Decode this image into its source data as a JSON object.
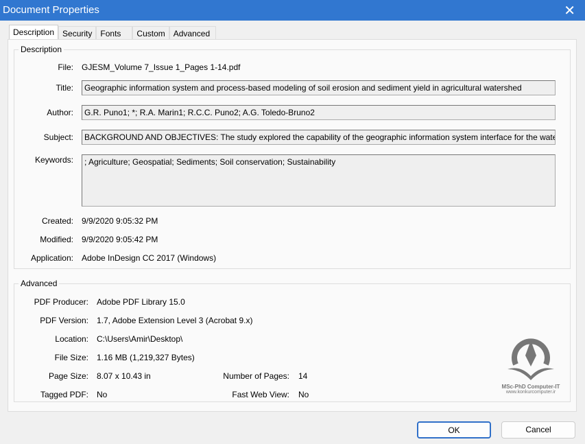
{
  "window": {
    "title": "Document Properties"
  },
  "tabs": [
    "Description",
    "Security",
    "Fonts",
    "Custom",
    "Advanced"
  ],
  "description": {
    "legend": "Description",
    "file_label": "File:",
    "file": "GJESM_Volume 7_Issue 1_Pages 1-14.pdf",
    "title_label": "Title:",
    "title": "Geographic information system and process-based modeling of soil erosion and sediment yield in agricultural watershed",
    "author_label": "Author:",
    "author": "G.R. Puno1; *; R.A. Marin1; R.C.C. Puno2; A.G. Toledo-Bruno2",
    "subject_label": "Subject:",
    "subject": "BACKGROUND AND OBJECTIVES: The study explored the capability of the geographic information system interface for the water er",
    "keywords_label": "Keywords:",
    "keywords": "; Agriculture; Geospatial; Sediments; Soil conservation; Sustainability",
    "created_label": "Created:",
    "created": "9/9/2020 9:05:32 PM",
    "modified_label": "Modified:",
    "modified": "9/9/2020 9:05:42 PM",
    "application_label": "Application:",
    "application": "Adobe InDesign CC 2017 (Windows)"
  },
  "advanced": {
    "legend": "Advanced",
    "producer_label": "PDF Producer:",
    "producer": "Adobe PDF Library 15.0",
    "version_label": "PDF Version:",
    "version": "1.7, Adobe Extension Level 3 (Acrobat 9.x)",
    "location_label": "Location:",
    "location": "C:\\Users\\Amir\\Desktop\\",
    "filesize_label": "File Size:",
    "filesize": "1.16 MB (1,219,327 Bytes)",
    "pagesize_label": "Page Size:",
    "pagesize": "8.07 x 10.43 in",
    "pages_label": "Number of Pages:",
    "pages": "14",
    "tagged_label": "Tagged PDF:",
    "tagged": "No",
    "fastweb_label": "Fast Web View:",
    "fastweb": "No"
  },
  "watermark": {
    "line1": "MSc-PhD Computer-IT",
    "line2": "www.konkurcomputer.ir"
  },
  "buttons": {
    "ok": "OK",
    "cancel": "Cancel"
  }
}
